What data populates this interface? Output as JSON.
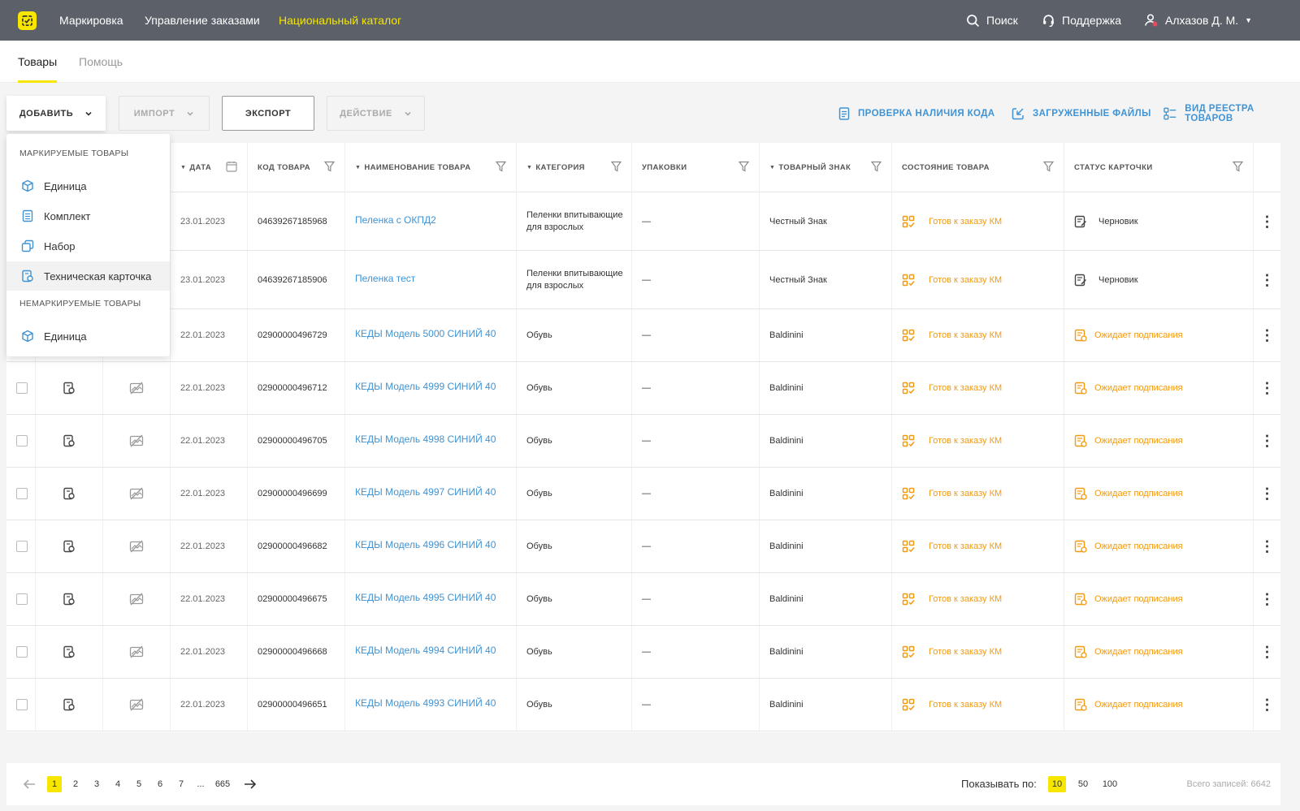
{
  "header": {
    "nav": [
      "Маркировка",
      "Управление заказами",
      "Национальный каталог"
    ],
    "active_nav": "Национальный каталог",
    "search_label": "Поиск",
    "support_label": "Поддержка",
    "user_name": "Алхазов Д. М."
  },
  "tabs": [
    "Товары",
    "Помощь"
  ],
  "toolbar": {
    "add_label": "ДОБАВИТЬ",
    "import_label": "ИМПОРТ",
    "export_label": "ЭКСПОРТ",
    "action_label": "ДЕЙСТВИЕ",
    "links": [
      "ПРОВЕРКА НАЛИЧИЯ КОДА",
      "ЗАГРУЖЕННЫЕ ФАЙЛЫ",
      "ВИД РЕЕСТРА ТОВАРОВ"
    ]
  },
  "dropdown": {
    "marked_heading": "МАРКИРУЕМЫЕ ТОВАРЫ",
    "marked_items": [
      "Единица",
      "Комплект",
      "Набор",
      "Техническая карточка"
    ],
    "unmarked_heading": "НЕМАРКИРУЕМЫЕ ТОВАРЫ",
    "unmarked_items": [
      "Единица"
    ]
  },
  "table": {
    "columns": [
      "ДАТА",
      "КОД ТОВАРА",
      "НАИМЕНОВАНИЕ ТОВАРА",
      "КАТЕГОРИЯ",
      "УПАКОВКИ",
      "ТОВАРНЫЙ ЗНАК",
      "СОСТОЯНИЕ ТОВАРА",
      "СТАТУС КАРТОЧКИ"
    ],
    "rows": [
      {
        "date": "23.01.2023",
        "code": "04639267185968",
        "name": "Пеленка с ОКПД2",
        "category": "Пеленки впитывающие для взрослых",
        "packages": "—",
        "brand": "Честный Знак",
        "state": "Готов к заказу КМ",
        "status": "Черновик"
      },
      {
        "date": "23.01.2023",
        "code": "04639267185906",
        "name": "Пеленка тест",
        "category": "Пеленки впитывающие для взрослых",
        "packages": "—",
        "brand": "Честный Знак",
        "state": "Готов к заказу КМ",
        "status": "Черновик"
      },
      {
        "date": "22.01.2023",
        "code": "02900000496729",
        "name": "КЕДЫ Модель 5000 СИНИЙ 40",
        "category": "Обувь",
        "packages": "—",
        "brand": "Baldinini",
        "state": "Готов к заказу КМ",
        "status": "Ожидает подписания"
      },
      {
        "date": "22.01.2023",
        "code": "02900000496712",
        "name": "КЕДЫ Модель 4999 СИНИЙ 40",
        "category": "Обувь",
        "packages": "—",
        "brand": "Baldinini",
        "state": "Готов к заказу КМ",
        "status": "Ожидает подписания"
      },
      {
        "date": "22.01.2023",
        "code": "02900000496705",
        "name": "КЕДЫ Модель 4998 СИНИЙ 40",
        "category": "Обувь",
        "packages": "—",
        "brand": "Baldinini",
        "state": "Готов к заказу КМ",
        "status": "Ожидает подписания"
      },
      {
        "date": "22.01.2023",
        "code": "02900000496699",
        "name": "КЕДЫ Модель 4997 СИНИЙ 40",
        "category": "Обувь",
        "packages": "—",
        "brand": "Baldinini",
        "state": "Готов к заказу КМ",
        "status": "Ожидает подписания"
      },
      {
        "date": "22.01.2023",
        "code": "02900000496682",
        "name": "КЕДЫ Модель 4996 СИНИЙ 40",
        "category": "Обувь",
        "packages": "—",
        "brand": "Baldinini",
        "state": "Готов к заказу КМ",
        "status": "Ожидает подписания"
      },
      {
        "date": "22.01.2023",
        "code": "02900000496675",
        "name": "КЕДЫ Модель 4995 СИНИЙ 40",
        "category": "Обувь",
        "packages": "—",
        "brand": "Baldinini",
        "state": "Готов к заказу КМ",
        "status": "Ожидает подписания"
      },
      {
        "date": "22.01.2023",
        "code": "02900000496668",
        "name": "КЕДЫ Модель 4994 СИНИЙ 40",
        "category": "Обувь",
        "packages": "—",
        "brand": "Baldinini",
        "state": "Готов к заказу КМ",
        "status": "Ожидает подписания"
      },
      {
        "date": "22.01.2023",
        "code": "02900000496651",
        "name": "КЕДЫ Модель 4993 СИНИЙ 40",
        "category": "Обувь",
        "packages": "—",
        "brand": "Baldinini",
        "state": "Готов к заказу КМ",
        "status": "Ожидает подписания"
      }
    ]
  },
  "pagination": {
    "pages": [
      "1",
      "2",
      "3",
      "4",
      "5",
      "6",
      "7",
      "...",
      "665"
    ],
    "current": "1",
    "per_page_label": "Показывать по:",
    "per_page_options": [
      "10",
      "50",
      "100"
    ],
    "per_page_selected": "10",
    "total_label": "Всего записей: 6642"
  },
  "colors": {
    "topbar": "#5b6069",
    "accent": "#f6e600",
    "link": "#3f93d4",
    "orange": "#f29a10"
  }
}
